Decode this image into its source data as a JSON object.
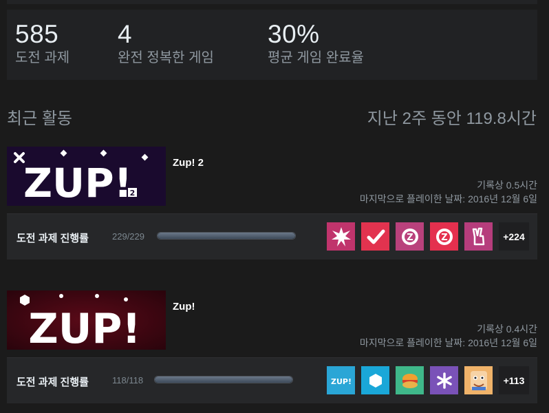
{
  "stats": [
    {
      "value": "585",
      "label": "도전 과제"
    },
    {
      "value": "4",
      "label": "완전 정복한 게임"
    },
    {
      "value": "30%",
      "label": "평균 게임 완료율"
    }
  ],
  "recent": {
    "title": "최근 활동",
    "summary": "지난 2주 동안 119.8시간"
  },
  "games": [
    {
      "name": "Zup! 2",
      "logo": "ZUP!",
      "hours": "기록상 0.5시간",
      "last_played": "마지막으로 플레이한 날짜: 2016년 12월 6일",
      "ach_label": "도전 과제 진행률",
      "ach_count": "229/229",
      "ach_progress": 1.0,
      "ach_more": "+224",
      "ach_icons": [
        "starburst-icon",
        "checkmark-icon",
        "z-coin-icon",
        "z-coin-red-icon",
        "peace-hand-icon"
      ]
    },
    {
      "name": "Zup!",
      "logo": "ZUP!",
      "hours": "기록상 0.4시간",
      "last_played": "마지막으로 플레이한 날짜: 2016년 12월 6일",
      "ach_label": "도전 과제 진행률",
      "ach_count": "118/118",
      "ach_progress": 1.0,
      "ach_more": "+113",
      "ach_icons": [
        "zup-logo-icon",
        "hexagon-icon",
        "burger-icon",
        "asterisk-icon",
        "character-icon"
      ]
    }
  ],
  "colors": {
    "accent": "#e8eef2",
    "muted": "#8f98a0",
    "zup2_bg": "#1a0a2e",
    "zup_bg": "#3a0610"
  }
}
